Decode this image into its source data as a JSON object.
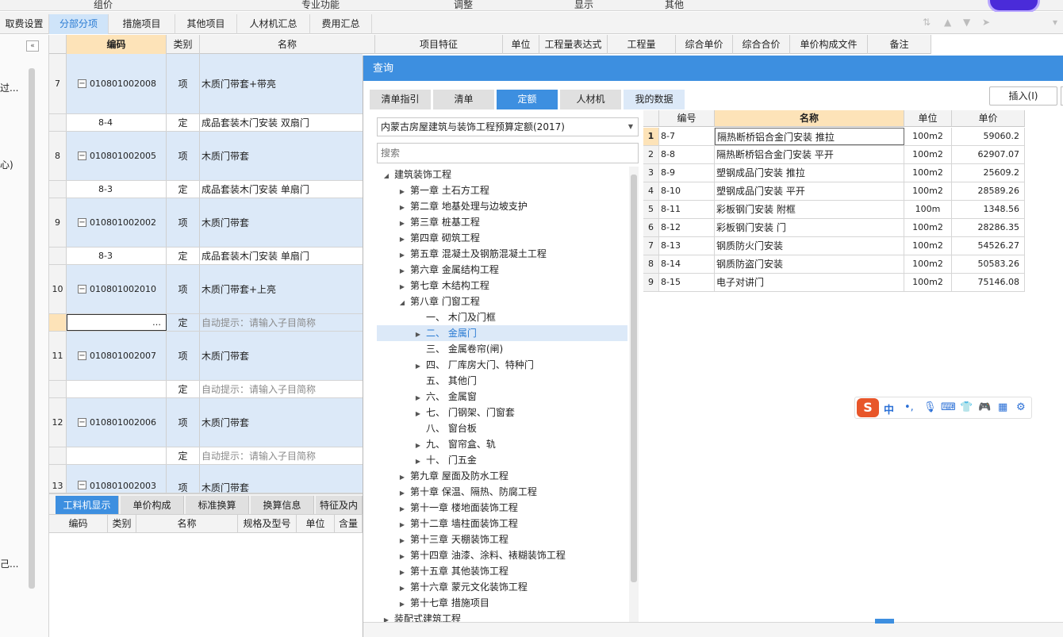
{
  "topbar": {
    "items": [
      "组价",
      "专业功能",
      "调整",
      "显示",
      "其他"
    ]
  },
  "tabs": [
    "取费设置",
    "分部分项",
    "措施项目",
    "其他项目",
    "人材机汇总",
    "费用汇总"
  ],
  "left_pane": {
    "items": [
      "过...",
      "心)",
      "己..."
    ]
  },
  "grid": {
    "headers": [
      "编码",
      "类别",
      "名称",
      "项目特征",
      "单位",
      "工程量表达式",
      "工程量",
      "综合单价",
      "综合合价",
      "单价构成文件",
      "备注"
    ],
    "rows": [
      {
        "num": "7",
        "code": "010801002008",
        "type": "项",
        "name": "木质门带套+带亮"
      },
      {
        "num": "",
        "code": "8-4",
        "type": "定",
        "name": "成品套装木门安装 双扇门"
      },
      {
        "num": "8",
        "code": "010801002005",
        "type": "项",
        "name": "木质门带套"
      },
      {
        "num": "",
        "code": "8-3",
        "type": "定",
        "name": "成品套装木门安装 单扇门"
      },
      {
        "num": "9",
        "code": "010801002002",
        "type": "项",
        "name": "木质门带套"
      },
      {
        "num": "",
        "code": "8-3",
        "type": "定",
        "name": "成品套装木门安装 单扇门"
      },
      {
        "num": "10",
        "code": "010801002010",
        "type": "项",
        "name": "木质门带套+上亮"
      },
      {
        "num": "",
        "code": "…",
        "type": "定",
        "name": "自动提示：请输入子目简称"
      },
      {
        "num": "11",
        "code": "010801002007",
        "type": "项",
        "name": "木质门带套"
      },
      {
        "num": "",
        "code": "",
        "type": "定",
        "name": "自动提示：请输入子目简称"
      },
      {
        "num": "12",
        "code": "010801002006",
        "type": "项",
        "name": "木质门带套"
      },
      {
        "num": "",
        "code": "",
        "type": "定",
        "name": "自动提示：请输入子目简称"
      },
      {
        "num": "13",
        "code": "010801002003",
        "type": "项",
        "name": "木质门带套"
      }
    ]
  },
  "bottom_panel": {
    "tabs": [
      "工料机显示",
      "单价构成",
      "标准换算",
      "换算信息",
      "特征及内"
    ],
    "headers": [
      "编码",
      "类别",
      "名称",
      "规格及型号",
      "单位",
      "含量"
    ]
  },
  "dialog": {
    "title": "查询",
    "tabs": [
      "清单指引",
      "清单",
      "定额",
      "人材机",
      "我的数据"
    ],
    "insert_button": "插入(I)",
    "quota_select": "内蒙古房屋建筑与装饰工程预算定额(2017)",
    "search_placeholder": "搜索",
    "tree": [
      {
        "label": "建筑装饰工程",
        "level": 0,
        "arrow": "down"
      },
      {
        "label": "第一章 土石方工程",
        "level": 1,
        "arrow": "right"
      },
      {
        "label": "第二章 地基处理与边坡支护",
        "level": 1,
        "arrow": "right"
      },
      {
        "label": "第三章 桩基工程",
        "level": 1,
        "arrow": "right"
      },
      {
        "label": "第四章 砌筑工程",
        "level": 1,
        "arrow": "right"
      },
      {
        "label": "第五章 混凝土及钢筋混凝土工程",
        "level": 1,
        "arrow": "right"
      },
      {
        "label": "第六章 金属结构工程",
        "level": 1,
        "arrow": "right"
      },
      {
        "label": "第七章 木结构工程",
        "level": 1,
        "arrow": "right"
      },
      {
        "label": "第八章 门窗工程",
        "level": 1,
        "arrow": "down"
      },
      {
        "label": "一、 木门及门框",
        "level": 2,
        "arrow": ""
      },
      {
        "label": "二、 金属门",
        "level": 2,
        "arrow": "right",
        "selected": true
      },
      {
        "label": "三、 金属卷帘(闸)",
        "level": 2,
        "arrow": ""
      },
      {
        "label": "四、 厂库房大门、特种门",
        "level": 2,
        "arrow": "right"
      },
      {
        "label": "五、 其他门",
        "level": 2,
        "arrow": ""
      },
      {
        "label": "六、 金属窗",
        "level": 2,
        "arrow": "right"
      },
      {
        "label": "七、 门钢架、门窗套",
        "level": 2,
        "arrow": "right"
      },
      {
        "label": "八、 窗台板",
        "level": 2,
        "arrow": ""
      },
      {
        "label": "九、 窗帘盒、轨",
        "level": 2,
        "arrow": "right"
      },
      {
        "label": "十、 门五金",
        "level": 2,
        "arrow": "right"
      },
      {
        "label": "第九章 屋面及防水工程",
        "level": 1,
        "arrow": "right"
      },
      {
        "label": "第十章 保温、隔热、防腐工程",
        "level": 1,
        "arrow": "right"
      },
      {
        "label": "第十一章 楼地面装饰工程",
        "level": 1,
        "arrow": "right"
      },
      {
        "label": "第十二章 墙柱面装饰工程",
        "level": 1,
        "arrow": "right"
      },
      {
        "label": "第十三章 天棚装饰工程",
        "level": 1,
        "arrow": "right"
      },
      {
        "label": "第十四章 油漆、涂料、裱糊装饰工程",
        "level": 1,
        "arrow": "right"
      },
      {
        "label": "第十五章 其他装饰工程",
        "level": 1,
        "arrow": "right"
      },
      {
        "label": "第十六章 蒙元文化装饰工程",
        "level": 1,
        "arrow": "right"
      },
      {
        "label": "第十七章 措施项目",
        "level": 1,
        "arrow": "right"
      },
      {
        "label": "装配式建筑工程",
        "level": 0,
        "arrow": "right"
      }
    ],
    "result_table": {
      "headers": [
        "编号",
        "名称",
        "单位",
        "单价"
      ],
      "rows": [
        {
          "n": "1",
          "code": "8-7",
          "name": "隔热断桥铝合金门安装 推拉",
          "unit": "100m2",
          "price": "59060.2"
        },
        {
          "n": "2",
          "code": "8-8",
          "name": "隔热断桥铝合金门安装 平开",
          "unit": "100m2",
          "price": "62907.07"
        },
        {
          "n": "3",
          "code": "8-9",
          "name": "塑钢成品门安装 推拉",
          "unit": "100m2",
          "price": "25609.2"
        },
        {
          "n": "4",
          "code": "8-10",
          "name": "塑钢成品门安装 平开",
          "unit": "100m2",
          "price": "28589.26"
        },
        {
          "n": "5",
          "code": "8-11",
          "name": "彩板钢门安装 附框",
          "unit": "100m",
          "price": "1348.56"
        },
        {
          "n": "6",
          "code": "8-12",
          "name": "彩板钢门安装 门",
          "unit": "100m2",
          "price": "28286.35"
        },
        {
          "n": "7",
          "code": "8-13",
          "name": "钢质防火门安装",
          "unit": "100m2",
          "price": "54526.27"
        },
        {
          "n": "8",
          "code": "8-14",
          "name": "钢质防盗门安装",
          "unit": "100m2",
          "price": "50583.26"
        },
        {
          "n": "9",
          "code": "8-15",
          "name": "电子对讲门",
          "unit": "100m2",
          "price": "75146.08"
        }
      ]
    }
  },
  "ime_toolbar": {
    "logo": "S",
    "lang": "中"
  }
}
